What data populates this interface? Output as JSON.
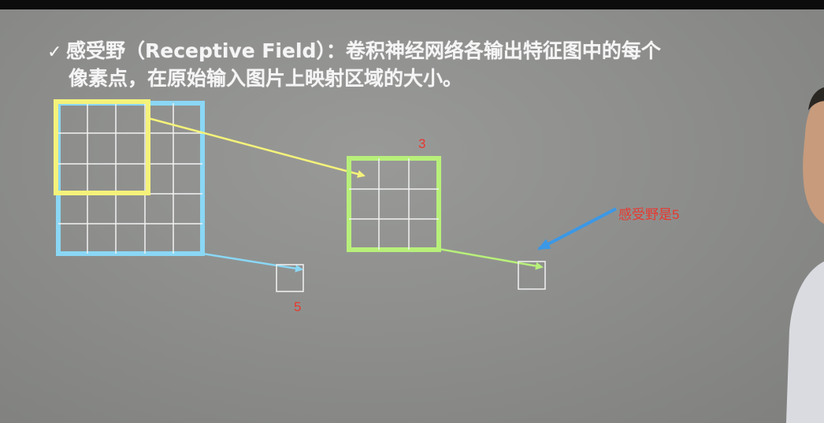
{
  "slide": {
    "checkmark": "✓",
    "line1": "感受野（Receptive Field）：卷积神经网络各输出特征图中的每个",
    "line2": "像素点，在原始输入图片上映射区域的大小。"
  },
  "annotations": {
    "label_3": "3",
    "label_5": "5",
    "label_receptive": "感受野是5"
  },
  "colors": {
    "blue": "#8ad7f5",
    "yellow": "#f4f27a",
    "green": "#b8f07a",
    "white_grid": "#f2f2f2",
    "red_text": "#e8382f",
    "arrow_blue": "#3b98e6"
  },
  "diagram": {
    "input_grid": {
      "rows": 5,
      "cols": 5
    },
    "receptive_window": {
      "rows": 3,
      "cols": 3
    },
    "middle_feature_map": {
      "rows": 3,
      "cols": 3
    },
    "output_pixel": {
      "rows": 1,
      "cols": 1
    }
  }
}
